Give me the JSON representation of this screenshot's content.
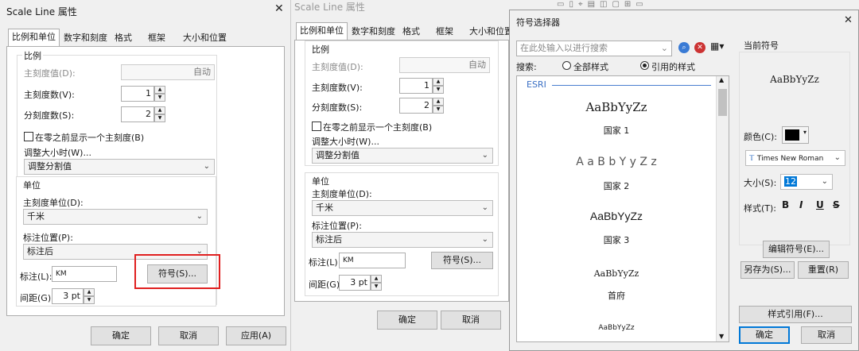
{
  "dialog1": {
    "title": "Scale Line 属性",
    "tabs": [
      "比例和单位",
      "数字和刻度",
      "格式",
      "框架",
      "大小和位置"
    ],
    "scale_group": {
      "title": "比例",
      "major_value_label": "主刻度值(D):",
      "major_value": "自动",
      "major_count_label": "主刻度数(V):",
      "major_count": "1",
      "sub_count_label": "分刻度数(S):",
      "sub_count": "2",
      "show_before_zero": "在零之前显示一个主刻度(B)",
      "resize_label": "调整大小时(W)...",
      "resize_value": "调整分割值"
    },
    "units_group": {
      "title": "单位",
      "major_unit_label": "主刻度单位(D):",
      "major_unit": "千米",
      "label_pos_label": "标注位置(P):",
      "label_pos": "标注后",
      "label_label": "标注(L):",
      "label_value": "KM",
      "symbol_button": "符号(S)...",
      "gap_label": "间距(G):",
      "gap_value": "3 pt"
    },
    "ok": "确定",
    "cancel": "取消",
    "apply": "应用(A)"
  },
  "dialog2": {
    "title": "Scale Line 属性",
    "tabs": [
      "比例和单位",
      "数字和刻度",
      "格式",
      "框架",
      "大小和位置"
    ],
    "scale_group": {
      "title": "比例",
      "major_value_label": "主刻度值(D):",
      "major_value": "自动",
      "major_count_label": "主刻度数(V):",
      "major_count": "1",
      "sub_count_label": "分刻度数(S):",
      "sub_count": "2",
      "show_before_zero": "在零之前显示一个主刻度(B)",
      "resize_label": "调整大小时(W)...",
      "resize_value": "调整分割值"
    },
    "units_group": {
      "title": "单位",
      "major_unit_label": "主刻度单位(D):",
      "major_unit": "千米",
      "label_pos_label": "标注位置(P):",
      "label_pos": "标注后",
      "label_label": "标注(L):",
      "label_value": "KM",
      "symbol_button": "符号(S)...",
      "gap_label": "间距(G):",
      "gap_value": "3 pt"
    },
    "ok": "确定",
    "cancel": "取消"
  },
  "symbol_selector": {
    "title": "符号选择器",
    "search_placeholder": "在此处输入以进行搜索",
    "search_label": "搜索:",
    "radio_all": "全部样式",
    "radio_ref": "引用的样式",
    "style_group": "ESRI",
    "symbols": [
      {
        "sample": "AaBbYyZz",
        "name": "国家 1"
      },
      {
        "sample": "A a B b Y y Z z",
        "name": "国家 2"
      },
      {
        "sample": "AaBbYyZz",
        "name": "国家 3"
      },
      {
        "sample": "AaBbYyZz",
        "name": "首府"
      },
      {
        "sample": "AaBbYyZz",
        "name": ""
      }
    ],
    "current_symbol_label": "当前符号",
    "current_sample": "AaBbYyZz",
    "color_label": "颜色(C):",
    "color_value": "#000000",
    "font_value": "Times New Roman",
    "size_label": "大小(S):",
    "size_value": "12",
    "style_label": "样式(T):",
    "bold": "B",
    "italic": "I",
    "underline": "U",
    "strike": "S",
    "edit_symbol": "编辑符号(E)...",
    "save_as": "另存为(S)...",
    "reset": "重置(R)",
    "style_refs": "样式引用(F)...",
    "ok": "确定",
    "cancel": "取消"
  },
  "colors": {
    "highlight": "#e02020",
    "accent": "#0078d7",
    "esri_line": "#4a7fd0"
  }
}
